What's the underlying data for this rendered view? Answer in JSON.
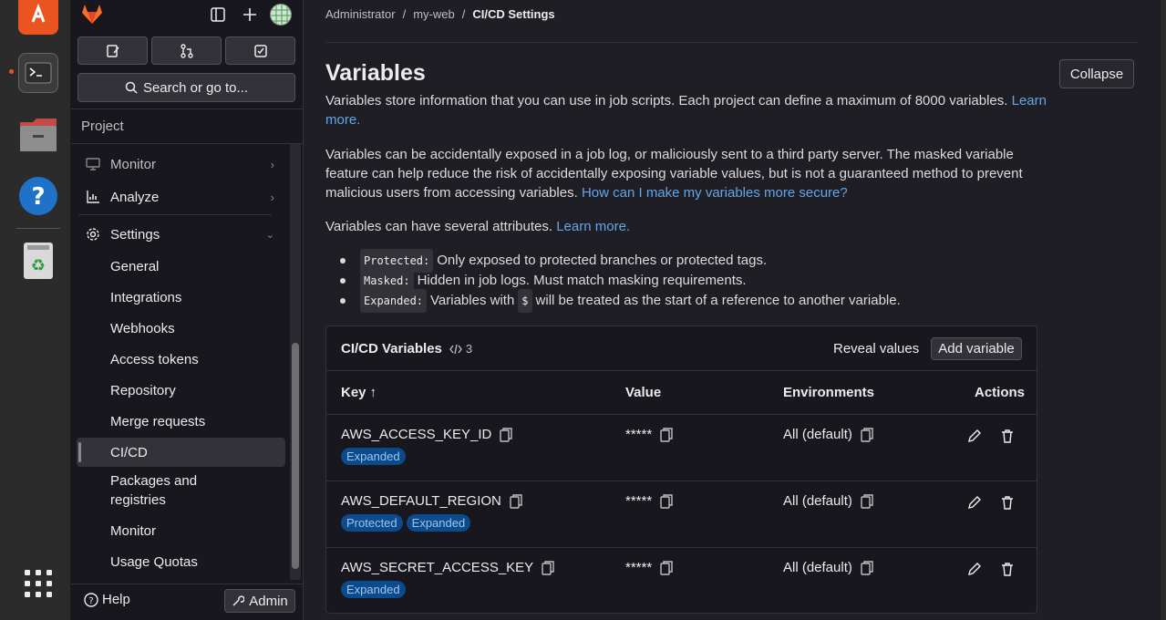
{
  "breadcrumbs": [
    "Administrator",
    "my-web",
    "CI/CD Settings"
  ],
  "sidebar": {
    "search_label": "Search or go to...",
    "section": "Project",
    "nav": [
      {
        "label": "Monitor",
        "type": "top",
        "chevron": "right"
      },
      {
        "label": "Analyze",
        "type": "top",
        "chevron": "right"
      },
      {
        "label": "Settings",
        "type": "top",
        "chevron": "down"
      },
      {
        "label": "General",
        "type": "sub"
      },
      {
        "label": "Integrations",
        "type": "sub"
      },
      {
        "label": "Webhooks",
        "type": "sub"
      },
      {
        "label": "Access tokens",
        "type": "sub"
      },
      {
        "label": "Repository",
        "type": "sub"
      },
      {
        "label": "Merge requests",
        "type": "sub"
      },
      {
        "label": "CI/CD",
        "type": "sub",
        "active": true
      },
      {
        "label": "Packages and registries",
        "type": "sub"
      },
      {
        "label": "Monitor",
        "type": "sub"
      },
      {
        "label": "Usage Quotas",
        "type": "sub"
      }
    ],
    "help_label": "Help",
    "admin_label": "Admin"
  },
  "page": {
    "title": "Variables",
    "collapse_label": "Collapse",
    "intro_text": "Variables store information that you can use in job scripts. Each project can define a maximum of 8000 variables.",
    "intro_link": "Learn more.",
    "security_text": "Variables can be accidentally exposed in a job log, or maliciously sent to a third party server. The masked variable feature can help reduce the risk of accidentally exposing variable values, but is not a guaranteed method to prevent malicious users from accessing variables.",
    "security_link": "How can I make my variables more secure?",
    "attributes_text": "Variables can have several attributes.",
    "attributes_link": "Learn more.",
    "bullets": [
      {
        "code": "Protected:",
        "text": "Only exposed to protected branches or protected tags."
      },
      {
        "code": "Masked:",
        "text": "Hidden in job logs. Must match masking requirements."
      },
      {
        "code": "Expanded:",
        "text_before": "Variables with",
        "code2": "$",
        "text": "will be treated as the start of a reference to another variable."
      }
    ]
  },
  "variables_card": {
    "title": "CI/CD Variables",
    "count": "3",
    "reveal_label": "Reveal values",
    "add_label": "Add variable",
    "columns": {
      "key": "Key",
      "value": "Value",
      "environments": "Environments",
      "actions": "Actions"
    },
    "rows": [
      {
        "key": "AWS_ACCESS_KEY_ID",
        "value": "*****",
        "environment": "All (default)",
        "badges": [
          "Expanded"
        ]
      },
      {
        "key": "AWS_DEFAULT_REGION",
        "value": "*****",
        "environment": "All (default)",
        "badges": [
          "Protected",
          "Expanded"
        ]
      },
      {
        "key": "AWS_SECRET_ACCESS_KEY",
        "value": "*****",
        "environment": "All (default)",
        "badges": [
          "Expanded"
        ]
      }
    ]
  },
  "colors": {
    "link": "#63a6e9",
    "badge_bg": "#0b4a8b",
    "badge_text": "#9dc7f1",
    "background": "#1f1e24",
    "sidebar": "#18171d"
  }
}
